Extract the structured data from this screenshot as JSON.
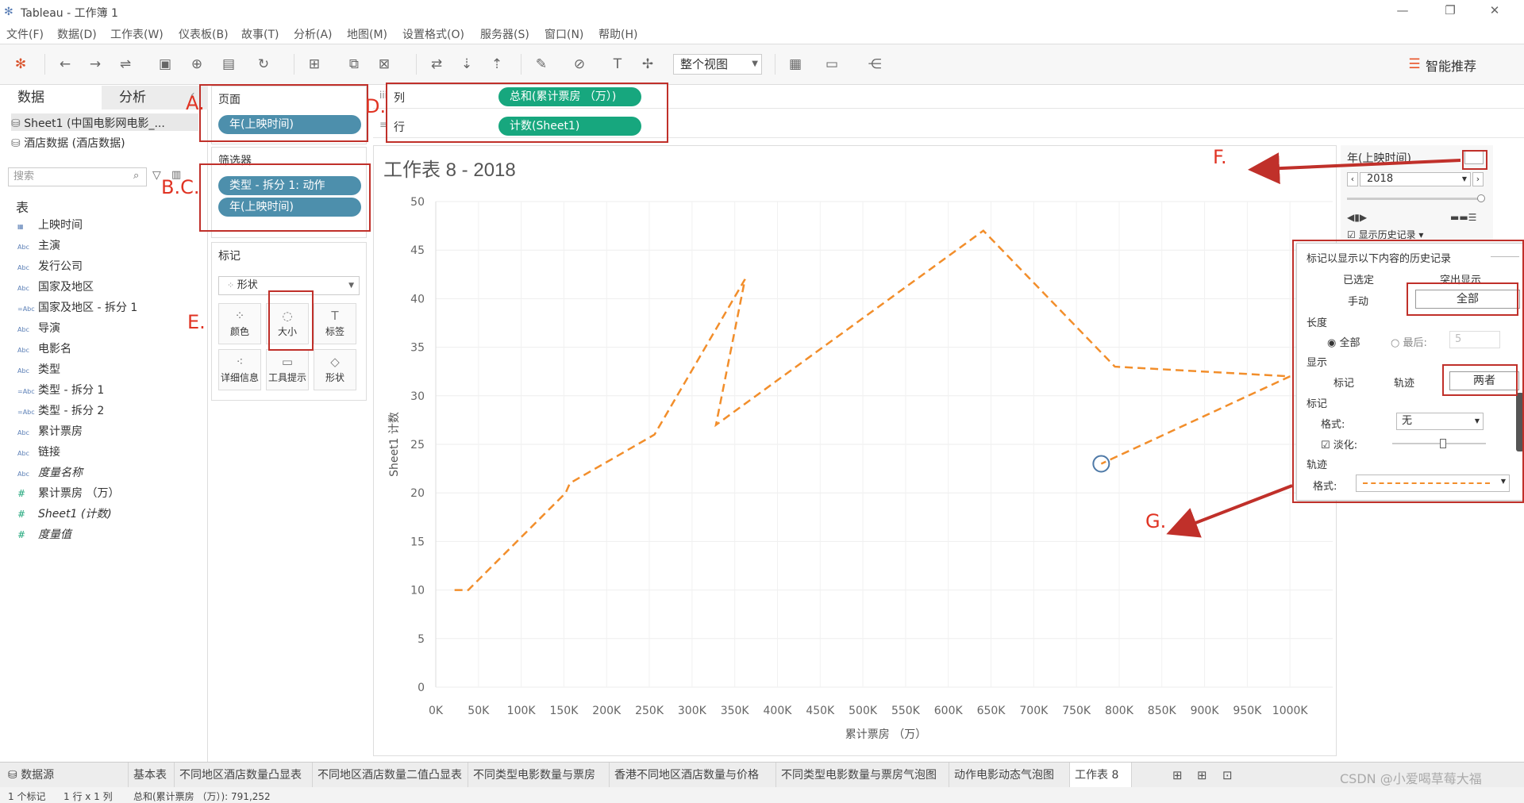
{
  "window": {
    "title": "Tableau - 工作簿 1",
    "minimize": "—",
    "restore": "❐",
    "close": "✕"
  },
  "menu": [
    "文件(F)",
    "数据(D)",
    "工作表(W)",
    "仪表板(B)",
    "故事(T)",
    "分析(A)",
    "地图(M)",
    "设置格式(O)",
    "服务器(S)",
    "窗口(N)",
    "帮助(H)"
  ],
  "toolbar": {
    "fit_view": "整个视图",
    "smart_recommend": "智能推荐"
  },
  "left": {
    "tab_data": "数据",
    "tab_analysis": "分析",
    "sources": [
      "Sheet1 (中国电影网电影_...",
      "酒店数据 (酒店数据)"
    ],
    "search_placeholder": "搜索",
    "table_header": "表",
    "fields": [
      {
        "type": "date",
        "icon": "▦",
        "name": "上映时间"
      },
      {
        "type": "dim",
        "icon": "Abc",
        "name": "主演"
      },
      {
        "type": "dim",
        "icon": "Abc",
        "name": "发行公司"
      },
      {
        "type": "dim",
        "icon": "Abc",
        "name": "国家及地区"
      },
      {
        "type": "dim",
        "icon": "=Abc",
        "name": "国家及地区 - 拆分 1"
      },
      {
        "type": "dim",
        "icon": "Abc",
        "name": "导演"
      },
      {
        "type": "dim",
        "icon": "Abc",
        "name": "电影名"
      },
      {
        "type": "dim",
        "icon": "Abc",
        "name": "类型"
      },
      {
        "type": "dim",
        "icon": "=Abc",
        "name": "类型 - 拆分 1"
      },
      {
        "type": "dim",
        "icon": "=Abc",
        "name": "类型 - 拆分 2"
      },
      {
        "type": "dim",
        "icon": "Abc",
        "name": "累计票房"
      },
      {
        "type": "dim",
        "icon": "Abc",
        "name": "链接"
      },
      {
        "type": "dim-italic",
        "icon": "Abc",
        "name": "度量名称"
      },
      {
        "type": "measure",
        "icon": "#",
        "name": "累计票房 （万）"
      },
      {
        "type": "measure-italic",
        "icon": "#",
        "name": "Sheet1 (计数)"
      },
      {
        "type": "measure-italic",
        "icon": "#",
        "name": "度量值"
      }
    ]
  },
  "cards": {
    "pages_title": "页面",
    "pages_pill": "年(上映时间)",
    "filters_title": "筛选器",
    "filter_pills": [
      "类型 - 拆分 1: 动作",
      "年(上映时间)"
    ],
    "marks_title": "标记",
    "marks_type": "形状",
    "mark_buttons": [
      {
        "icon": "color-icon",
        "glyph": "⁘",
        "label": "颜色"
      },
      {
        "icon": "size-icon",
        "glyph": "◌",
        "label": "大小"
      },
      {
        "icon": "label-icon",
        "glyph": "T",
        "label": "标签"
      },
      {
        "icon": "detail-icon",
        "glyph": "⁖",
        "label": "详细信息"
      },
      {
        "icon": "tooltip-icon",
        "glyph": "▭",
        "label": "工具提示"
      },
      {
        "icon": "shape-icon",
        "glyph": "◇",
        "label": "形状"
      }
    ]
  },
  "shelves": {
    "columns_label": "列",
    "columns_pill": "总和(累计票房 （万）)",
    "rows_label": "行",
    "rows_pill": "计数(Sheet1)"
  },
  "annotations": [
    "A.",
    "B.C.",
    "D.",
    "E.",
    "F.",
    "G."
  ],
  "chart_data": {
    "type": "line",
    "title": "工作表 8 - 2018",
    "xlabel": "累计票房 （万）",
    "ylabel": "Sheet1 计数",
    "xlim": [
      0,
      1050000
    ],
    "ylim": [
      0,
      50
    ],
    "xticks": [
      "0K",
      "50K",
      "100K",
      "150K",
      "200K",
      "250K",
      "300K",
      "350K",
      "400K",
      "450K",
      "500K",
      "550K",
      "600K",
      "650K",
      "700K",
      "750K",
      "800K",
      "850K",
      "900K",
      "950K",
      "1000K"
    ],
    "yticks": [
      0,
      5,
      10,
      15,
      20,
      25,
      30,
      35,
      40,
      45,
      50
    ],
    "line_color": "#f28e2b",
    "line_style": "dashed",
    "series": [
      {
        "x": [
          22000,
          38000,
          152000,
          157000,
          256000,
          362000,
          328000,
          641000,
          795000,
          1000000,
          779000
        ],
        "y": [
          10,
          10,
          20,
          21,
          26,
          42,
          27,
          47,
          33,
          32,
          23
        ]
      }
    ],
    "current_point": {
      "x": 779000,
      "y": 23
    }
  },
  "page_control": {
    "title": "年(上映时间)",
    "value": "2018",
    "show_history": "显示历史记录"
  },
  "history": {
    "header": "标记以显示以下内容的历史记录",
    "selected": "已选定",
    "highlighted": "突出显示",
    "manual": "手动",
    "all": "全部",
    "length": "长度",
    "length_all": "全部",
    "length_last": "最后:",
    "last_value": "5",
    "display": "显示",
    "marks": "标记",
    "trails": "轨迹",
    "both": "两者",
    "marks_section": "标记",
    "format": "格式:",
    "format_value": "无",
    "fade": "淡化:",
    "trail_section": "轨迹",
    "trail_format": "格式:"
  },
  "tabs": {
    "datasource": "数据源",
    "sheets": [
      "基本表",
      "不同地区酒店数量凸显表",
      "不同地区酒店数量二值凸显表",
      "不同类型电影数量与票房",
      "香港不同地区酒店数量与价格",
      "不同类型电影数量与票房气泡图",
      "动作电影动态气泡图",
      "工作表 8"
    ],
    "active": "工作表 8"
  },
  "status": {
    "marks": "1 个标记",
    "rows": "1 行 x 1 列",
    "sum": "总和(累计票房 （万）): 791,252"
  },
  "watermark": "CSDN @小爱喝草莓大福"
}
